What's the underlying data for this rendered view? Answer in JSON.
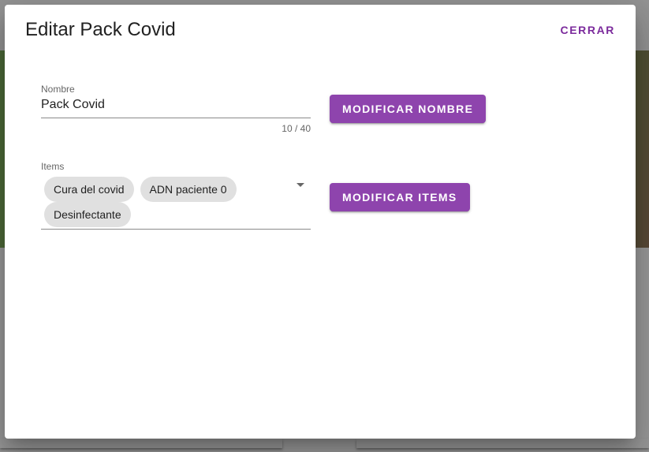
{
  "dialog": {
    "title": "Editar Pack Covid",
    "close_label": "CERRAR"
  },
  "name_field": {
    "label": "Nombre",
    "value": "Pack Covid",
    "counter": "10 / 40"
  },
  "name_button": {
    "label": "MODIFICAR NOMBRE"
  },
  "items_field": {
    "label": "Items",
    "chips": [
      "Cura del covid",
      "ADN paciente 0",
      "Desinfectante"
    ]
  },
  "items_button": {
    "label": "MODIFICAR ITEMS"
  },
  "colors": {
    "primary": "#8e44ad",
    "close_text": "#7b2a9c",
    "chip_bg": "#e0e0e0"
  }
}
